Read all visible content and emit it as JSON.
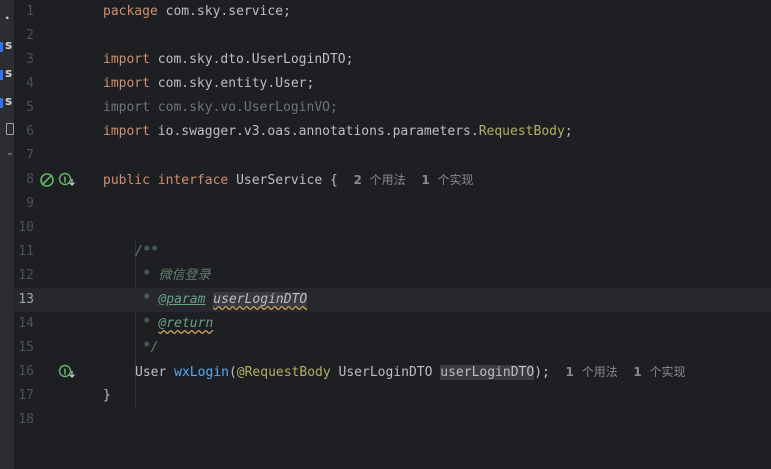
{
  "editor": {
    "lines": [
      {
        "n": "1"
      },
      {
        "n": "2"
      },
      {
        "n": "3"
      },
      {
        "n": "4"
      },
      {
        "n": "5"
      },
      {
        "n": "6"
      },
      {
        "n": "7"
      },
      {
        "n": "8"
      },
      {
        "n": "9"
      },
      {
        "n": "10"
      },
      {
        "n": "11"
      },
      {
        "n": "12"
      },
      {
        "n": "13"
      },
      {
        "n": "14"
      },
      {
        "n": "15"
      },
      {
        "n": "16"
      },
      {
        "n": "17"
      },
      {
        "n": "18"
      }
    ],
    "current_line": "13",
    "code": {
      "l1_kw": "package",
      "l1_rest": " com.sky.service;",
      "l3_kw": "import",
      "l3_rest": " com.sky.dto.UserLoginDTO;",
      "l4_text": "import com.sky.vo.UserLoginVO;",
      "l5_kw": "import",
      "l5_rest": " com.sky.entity.User;",
      "l6_kw": "import",
      "l6_pkg": " io.swagger.v3.oas.annotations.parameters.",
      "l6_ann": "RequestBody",
      "l6_end": ";",
      "l8_kw1": "public",
      "l8_kw2": "interface",
      "l8_name": " UserService {",
      "l8_hint_usages_num": "2",
      "l8_hint_usages_txt": "个用法",
      "l8_hint_impl_num": "1",
      "l8_hint_impl_txt": "个实现",
      "l11_text": "/**",
      "l12_text": " * 微信登录",
      "l13_star": " * ",
      "l13_tag": "@param",
      "l13_ref": "userLoginDTO",
      "l14_star": " * ",
      "l14_tag": "@return",
      "l15_text": " */",
      "l16_type": "User ",
      "l16_fn": "wxLogin",
      "l16_paren": "(",
      "l16_ann": "@RequestBody",
      "l16_ptype": " UserLoginDTO ",
      "l16_pname": "userLoginDTO",
      "l16_end": ");",
      "l16_hint_usages_num": "1",
      "l16_hint_usages_txt": "个用法",
      "l16_hint_impl_num": "1",
      "l16_hint_impl_txt": "个实现",
      "l17_text": "}"
    },
    "left_strip_letters": [
      ".",
      "s",
      "s",
      "s"
    ]
  },
  "colors": {
    "background": "#1e1f22",
    "keyword": "#cf8e6d",
    "annotation": "#b3ae60",
    "function": "#57aaf7",
    "comment": "#5f826b",
    "gutter_icon": "#5fb865"
  }
}
